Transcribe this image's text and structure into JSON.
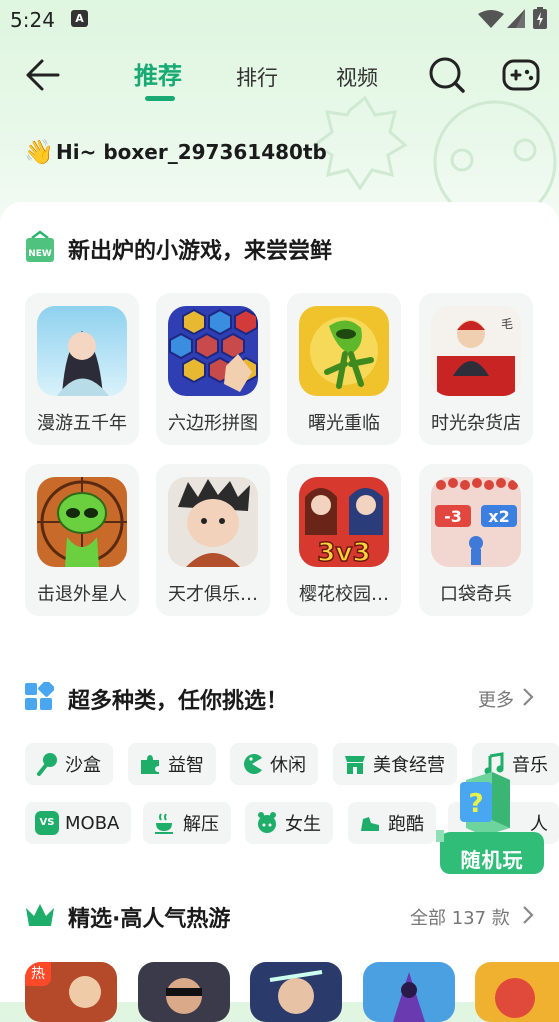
{
  "status": {
    "time": "5:24",
    "badge": "A"
  },
  "header": {
    "tabs": [
      "推荐",
      "排行",
      "视频"
    ],
    "active_tab": 0
  },
  "greeting": "Hi~ boxer_297361480tb",
  "new_games": {
    "title": "新出炉的小游戏，来尝尝鲜",
    "badge": "NEW",
    "items": [
      {
        "name": "漫游五千年"
      },
      {
        "name": "六边形拼图"
      },
      {
        "name": "曙光重临"
      },
      {
        "name": "时光杂货店"
      },
      {
        "name": "击退外星人"
      },
      {
        "name": "天才俱乐…"
      },
      {
        "name": "樱花校园…"
      },
      {
        "name": "口袋奇兵"
      }
    ]
  },
  "categories": {
    "title": "超多种类，任你挑选！",
    "more": "更多",
    "row1": [
      "沙盒",
      "益智",
      "休闲",
      "美食经营",
      "音乐"
    ],
    "row2": [
      "MOBA",
      "解压",
      "女生",
      "跑酷",
      "人"
    ],
    "moba_badge": "VS"
  },
  "random_play": {
    "label": "随机玩"
  },
  "featured": {
    "title": "精选·高人气热游",
    "count_label": "全部 137 款",
    "hot_badge": "热"
  },
  "colors": {
    "accent": "#19a974",
    "chip_bg": "#f3f4f4"
  }
}
